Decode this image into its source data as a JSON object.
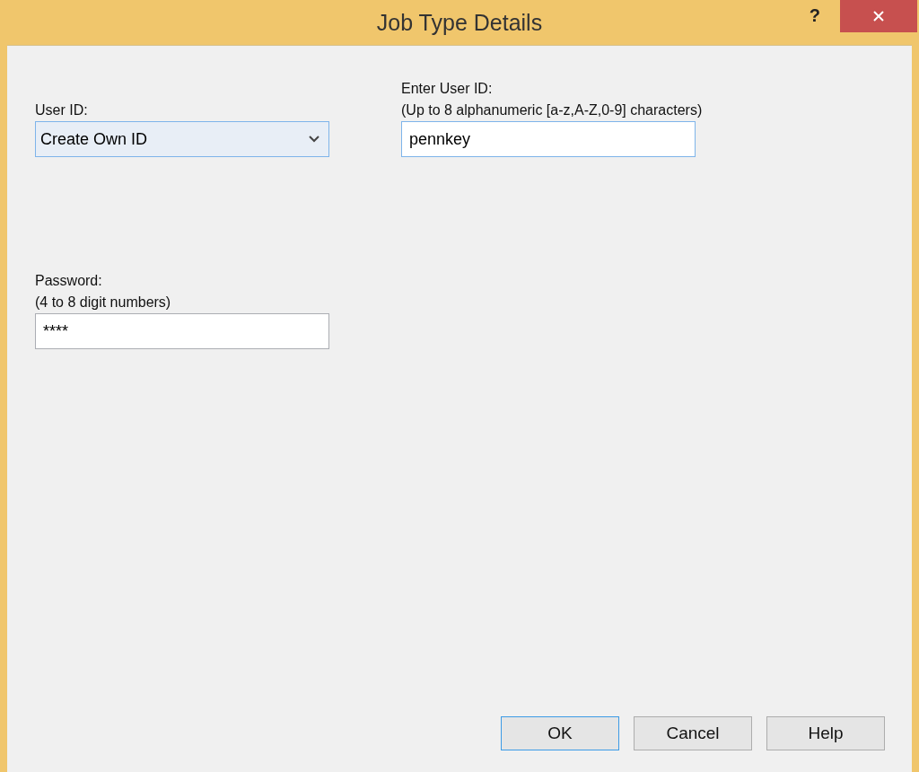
{
  "window": {
    "title": "Job Type Details",
    "help_glyph": "?"
  },
  "user_id": {
    "label": "User ID:",
    "value": "Create Own ID",
    "focused": true
  },
  "enter_user_id": {
    "label": "Enter User ID:",
    "hint": "(Up to 8 alphanumeric [a-z,A-Z,0-9] characters)",
    "value": "pennkey",
    "focused": true
  },
  "password": {
    "label": "Password:",
    "hint": "(4 to 8 digit numbers)",
    "value": "****",
    "focused": false
  },
  "buttons": [
    {
      "label": "OK",
      "focused": true
    },
    {
      "label": "Cancel",
      "focused": false
    },
    {
      "label": "Help",
      "focused": false
    }
  ]
}
